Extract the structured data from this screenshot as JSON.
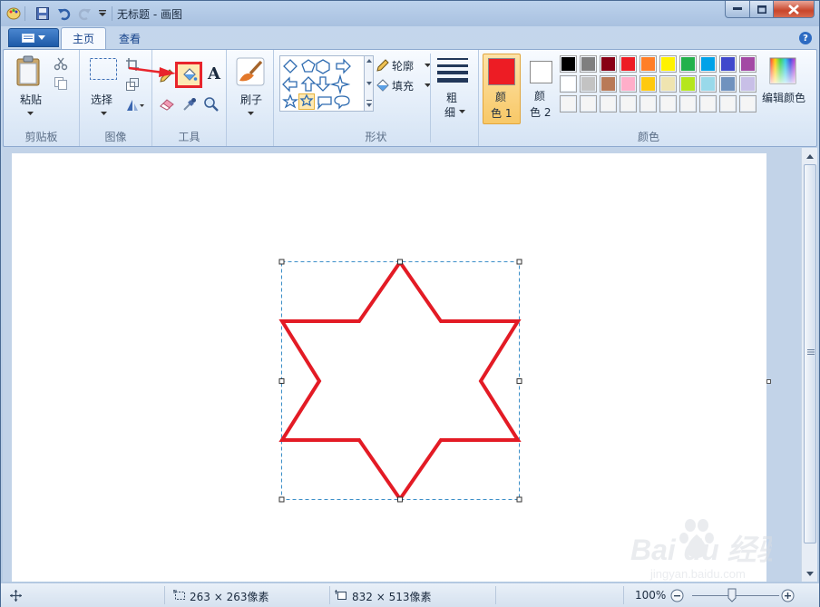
{
  "window": {
    "title": "无标题 - 画图"
  },
  "tabs": [
    {
      "label": "主页",
      "active": true
    },
    {
      "label": "查看",
      "active": false
    }
  ],
  "ribbon": {
    "clipboard": {
      "group_label": "剪贴板",
      "paste_label": "粘贴"
    },
    "image": {
      "group_label": "图像",
      "select_label": "选择"
    },
    "tools": {
      "group_label": "工具",
      "text_tool_glyph": "A",
      "highlighted_tool": "fill-bucket"
    },
    "brushes": {
      "label": "刷子"
    },
    "shapes": {
      "group_label": "形状",
      "outline_label": "轮廓",
      "fill_label": "填充",
      "selected_shape": "six-point-star"
    },
    "size": {
      "label_line1": "粗",
      "label_line2": "细"
    },
    "colors": {
      "group_label": "颜色",
      "color1_line1": "颜",
      "color1_line2": "色 1",
      "color2_line1": "颜",
      "color2_line2": "色 2",
      "color1_value": "#ed1c24",
      "color2_value": "#ffffff",
      "edit_colors_label": "编辑颜色",
      "palette_row1": [
        "#000000",
        "#7f7f7f",
        "#880015",
        "#ed1c24",
        "#ff7f27",
        "#fff200",
        "#22b14c",
        "#00a2e8",
        "#3f48cc",
        "#a349a4"
      ],
      "palette_row2": [
        "#ffffff",
        "#c3c3c3",
        "#b97a57",
        "#ffaec9",
        "#ffc90e",
        "#efe4b0",
        "#b5e61d",
        "#99d9ea",
        "#7092be",
        "#c8bfe7"
      ],
      "palette_row3": [
        "#f5f5f5",
        "#f5f5f5",
        "#f5f5f5",
        "#f5f5f5",
        "#f5f5f5",
        "#f5f5f5",
        "#f5f5f5",
        "#f5f5f5",
        "#f5f5f5",
        "#f5f5f5"
      ]
    }
  },
  "canvas": {
    "shape": "six-point-star",
    "stroke_color": "#e31b25",
    "selection_color": "#3c8fc8"
  },
  "statusbar": {
    "selection_size": "263 × 263像素",
    "canvas_size": "832 × 513像素",
    "zoom": "100%"
  },
  "watermark": {
    "brand": "Bai du 经验",
    "url": "jingyan.baidu.com"
  }
}
